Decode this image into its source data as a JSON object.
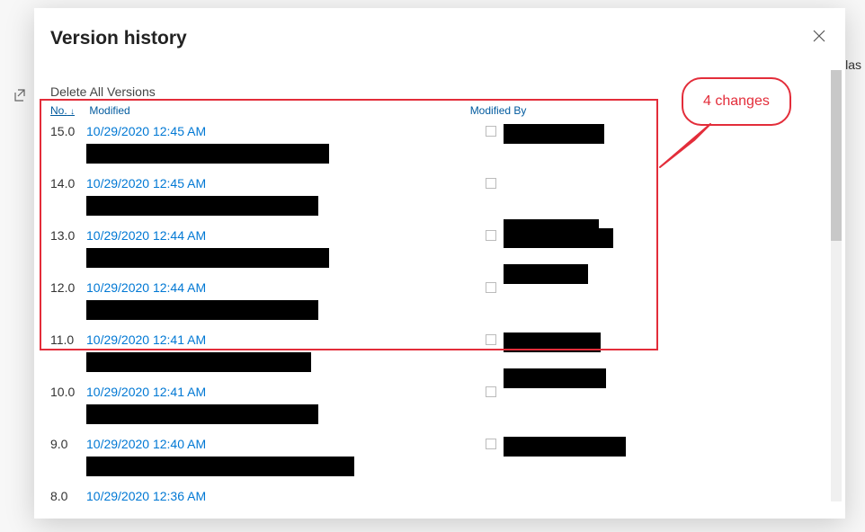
{
  "background": {
    "partial_text": "las"
  },
  "modal": {
    "title": "Version history",
    "delete_all": "Delete All Versions",
    "headers": {
      "no": "No.",
      "modified": "Modified",
      "modified_by": "Modified By"
    },
    "rows": [
      {
        "no": "15.0",
        "date": "10/29/2020 12:45 AM",
        "wA": 270,
        "wB": 112,
        "byOff": 0
      },
      {
        "no": "14.0",
        "date": "10/29/2020 12:45 AM",
        "wA": 258,
        "wB": 106,
        "byOff": 48
      },
      {
        "no": "13.0",
        "date": "10/29/2020 12:44 AM",
        "wA": 270,
        "wB": 122,
        "byOff": 0
      },
      {
        "no": "12.0",
        "date": "10/29/2020 12:44 AM",
        "wA": 258,
        "wB": 94,
        "byOff": -18
      },
      {
        "no": "11.0",
        "date": "10/29/2020 12:41 AM",
        "wA": 250,
        "wB": 108,
        "byOff": 0
      },
      {
        "no": "10.0",
        "date": "10/29/2020 12:41 AM",
        "wA": 258,
        "wB": 114,
        "byOff": -18
      },
      {
        "no": "9.0",
        "date": "10/29/2020 12:40 AM",
        "wA": 298,
        "wB": 136,
        "byOff": 0
      },
      {
        "no": "8.0",
        "date": "10/29/2020 12:36 AM",
        "wA": 0,
        "wB": 0,
        "byOff": 0
      }
    ]
  },
  "annotation": {
    "label": "4 changes"
  }
}
